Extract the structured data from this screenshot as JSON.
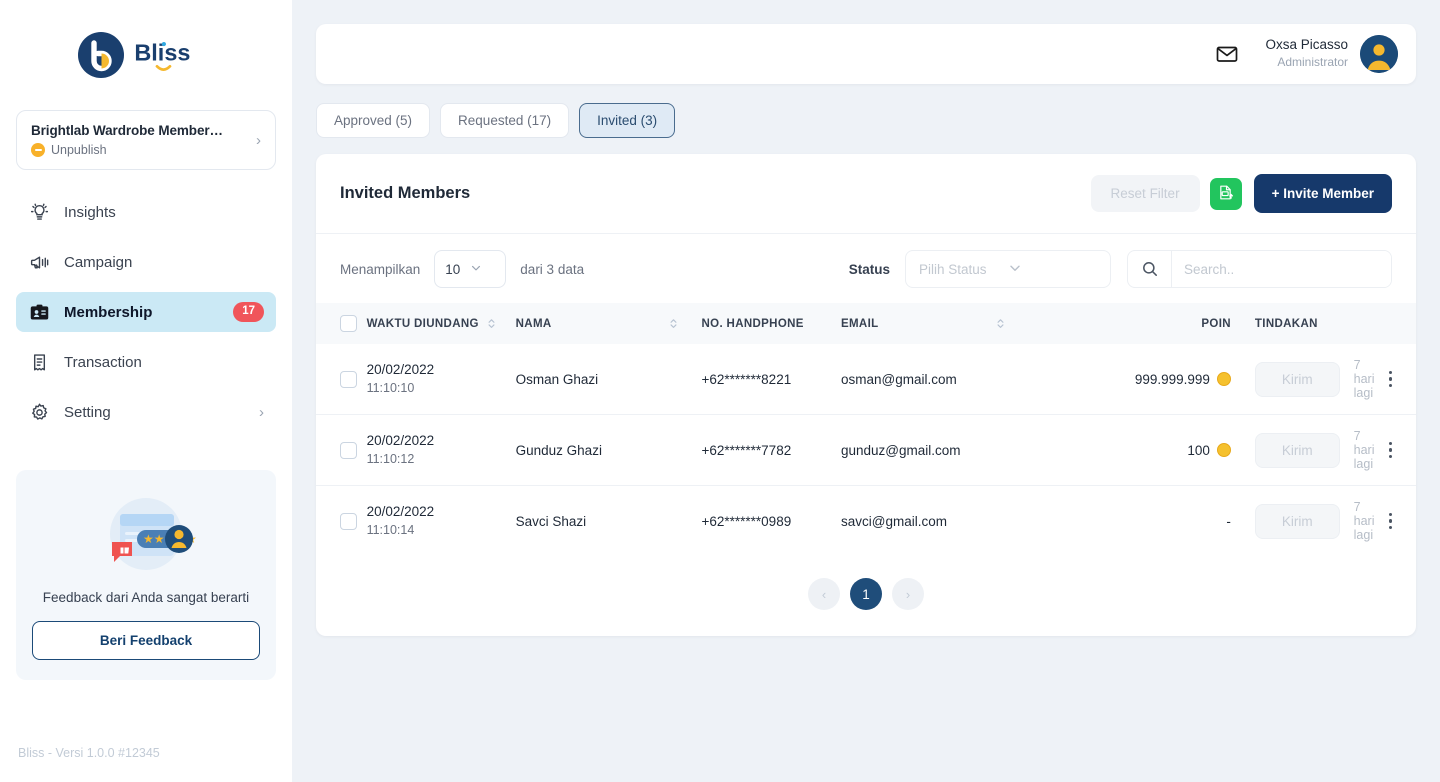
{
  "brand": {
    "name": "Bliss",
    "logo_icon": "bliss-logo-icon"
  },
  "sidebar": {
    "org": {
      "title": "Brightlab Wardrobe Member…",
      "status": "Unpublish",
      "chevron": "›"
    },
    "items": [
      {
        "label": "Insights",
        "icon": "insights-icon",
        "badge": "",
        "active": false
      },
      {
        "label": "Campaign",
        "icon": "megaphone-icon",
        "badge": "",
        "active": false
      },
      {
        "label": "Membership",
        "icon": "id-card-icon",
        "badge": "17",
        "active": true
      },
      {
        "label": "Transaction",
        "icon": "receipt-icon",
        "badge": "",
        "active": false
      },
      {
        "label": "Setting",
        "icon": "gear-icon",
        "badge": "",
        "active": false
      }
    ],
    "setting_chevron": "›",
    "feedback": {
      "text": "Feedback dari Anda sangat berarti",
      "button": "Beri Feedback"
    },
    "version": "Bliss - Versi 1.0.0 #12345"
  },
  "topbar": {
    "mail_icon": "mail-icon",
    "user_name": "Oxsa Picasso",
    "user_role": "Administrator"
  },
  "tabs": [
    {
      "label": "Approved (5)",
      "active": false
    },
    {
      "label": "Requested (17)",
      "active": false
    },
    {
      "label": "Invited (3)",
      "active": true
    }
  ],
  "card": {
    "title": "Invited Members",
    "reset_filter": "Reset Filter",
    "export_icon": "xls-export-icon",
    "invite_button": "+ Invite Member"
  },
  "filters": {
    "showing_label": "Menampilkan",
    "page_size": "10",
    "of_label": "dari 3 data",
    "status_label": "Status",
    "status_placeholder": "Pilih Status",
    "search_placeholder": "Search..",
    "search_value": "",
    "search_icon": "search-icon"
  },
  "table": {
    "columns": [
      {
        "label": "WAKTU DIUNDANG",
        "sortable": true
      },
      {
        "label": "NAMA",
        "sortable": true
      },
      {
        "label": "NO. HANDPHONE",
        "sortable": false
      },
      {
        "label": "EMAIL",
        "sortable": true
      },
      {
        "label": "POIN",
        "sortable": false
      },
      {
        "label": "TINDAKAN",
        "sortable": false
      }
    ],
    "rows": [
      {
        "date": "20/02/2022",
        "time": "11:10:10",
        "nama": "Osman Ghazi",
        "handphone": "+62*******8221",
        "email": "osman@gmail.com",
        "poin": "999.999.999",
        "has_coin": true,
        "action_button": "Kirim",
        "action_note": "7 hari lagi"
      },
      {
        "date": "20/02/2022",
        "time": "11:10:12",
        "nama": "Gunduz Ghazi",
        "handphone": "+62*******7782",
        "email": "gunduz@gmail.com",
        "poin": "100",
        "has_coin": true,
        "action_button": "Kirim",
        "action_note": "7 hari lagi"
      },
      {
        "date": "20/02/2022",
        "time": "11:10:14",
        "nama": "Savci Shazi",
        "handphone": "+62*******0989",
        "email": "savci@gmail.com",
        "poin": "-",
        "has_coin": false,
        "action_button": "Kirim",
        "action_note": "7 hari lagi"
      }
    ]
  },
  "pagination": {
    "prev": "‹",
    "current": "1",
    "next": "›"
  },
  "colors": {
    "brand_navy": "#16396b",
    "accent_yellow": "#f5c12e",
    "badge_red": "#f0555a",
    "active_nav": "#cbe9f5",
    "success_green": "#22c55e",
    "page_bg": "#eef2f7"
  }
}
